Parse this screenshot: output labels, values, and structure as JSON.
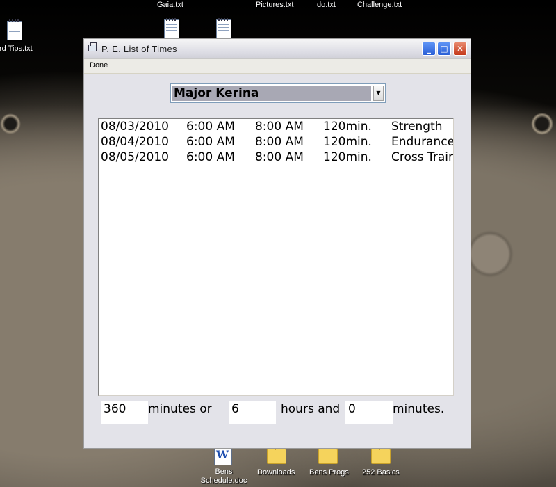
{
  "desktop": {
    "top_labels": [
      "Gaia.txt",
      "Pictures.txt",
      "do.txt",
      "Challenge.txt"
    ],
    "left_label": "rd Tips.txt",
    "bottom_icons": [
      {
        "label": "Bens Schedule.doc",
        "icon": "word-doc-icon"
      },
      {
        "label": "Downloads",
        "icon": "folder-icon"
      },
      {
        "label": "Bens Progs",
        "icon": "folder-icon"
      },
      {
        "label": "252 Basics",
        "icon": "folder-icon"
      }
    ]
  },
  "window": {
    "title": "P. E. List of Times",
    "controls": {
      "minimize": "_",
      "maximize": "□",
      "close": "✕"
    },
    "menu": [
      "Done"
    ],
    "dropdown": {
      "selected": "Major Kerina"
    },
    "entries": [
      {
        "date": "08/03/2010",
        "start": "6:00 AM",
        "end": "8:00 AM",
        "duration": "120min.",
        "type": "Strength"
      },
      {
        "date": "08/04/2010",
        "start": "6:00 AM",
        "end": "8:00 AM",
        "duration": "120min.",
        "type": "Endurance"
      },
      {
        "date": "08/05/2010",
        "start": "6:00 AM",
        "end": "8:00 AM",
        "duration": "120min.",
        "type": "Cross Training"
      }
    ],
    "summary": {
      "total_minutes": "360",
      "minutes_or_label": "minutes or",
      "hours": "6",
      "hours_and_label": "hours and",
      "remaining_minutes": "0",
      "minutes_label": "minutes."
    }
  },
  "colors": {
    "titlebar_close": "#c4381a",
    "titlebar_buttons": "#2a5fd6",
    "selection": "#a8a8b4"
  }
}
